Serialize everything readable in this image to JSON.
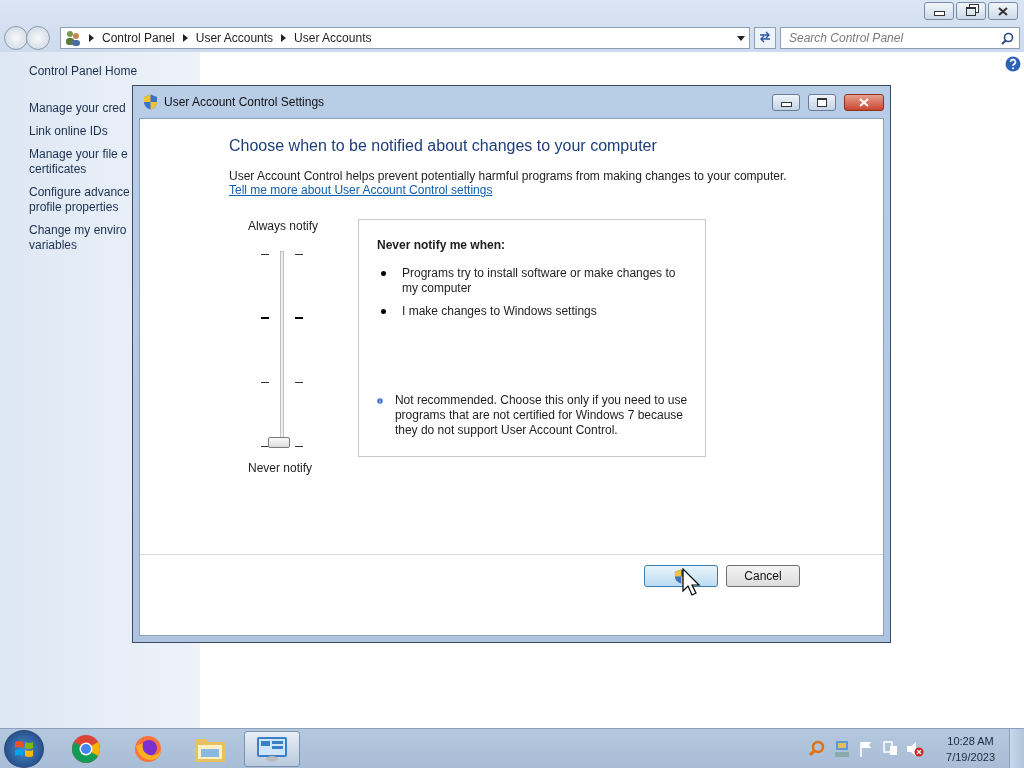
{
  "address_bar": {
    "crumbs": [
      "Control Panel",
      "User Accounts",
      "User Accounts"
    ],
    "search_placeholder": "Search Control Panel"
  },
  "sidebar": {
    "items": [
      {
        "lines": [
          "Control Panel Home"
        ],
        "kind": "home"
      },
      {
        "lines": [
          "Manage your cred"
        ],
        "kind": "link"
      },
      {
        "lines": [
          "Link online IDs"
        ],
        "kind": "link"
      },
      {
        "lines": [
          "Manage your file e",
          "certificates"
        ],
        "kind": "link"
      },
      {
        "lines": [
          "Configure advance",
          "profile properties"
        ],
        "kind": "link"
      },
      {
        "lines": [
          "Change my enviro",
          "variables"
        ],
        "kind": "link"
      }
    ]
  },
  "dialog": {
    "title": "User Account Control Settings",
    "heading": "Choose when to be notified about changes to your computer",
    "description": "User Account Control helps prevent potentially harmful programs from making changes to your computer.",
    "link": "Tell me more about User Account Control settings",
    "slider": {
      "top_label": "Always notify",
      "bottom_label": "Never notify",
      "level": 0
    },
    "info": {
      "title": "Never notify me when:",
      "bullets": [
        "Programs try to install software or make changes to my computer",
        "I make changes to Windows settings"
      ],
      "note": "Not recommended. Choose this only if you need to use programs that are not certified for Windows 7 because they do not support User Account Control."
    },
    "buttons": [
      {
        "kind": "ok",
        "focused": true
      },
      {
        "kind": "text",
        "label": "Cancel",
        "focused": false
      }
    ]
  },
  "taskbar": {
    "apps": [
      {
        "kind": "chrome",
        "selected": false
      },
      {
        "kind": "firefox",
        "selected": false
      },
      {
        "kind": "folder",
        "selected": false
      },
      {
        "kind": "control-panel",
        "selected": true
      }
    ],
    "time": "10:28 AM",
    "date": "7/19/2023"
  }
}
